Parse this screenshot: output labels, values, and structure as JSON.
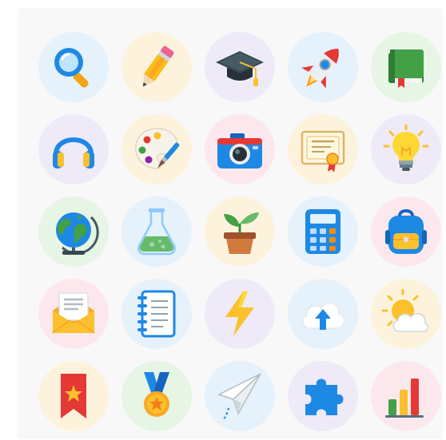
{
  "icons": [
    {
      "name": "search",
      "bg": "#e5f1fb"
    },
    {
      "name": "pencil",
      "bg": "#fdf3dc"
    },
    {
      "name": "graduation-cap",
      "bg": "#efeaf8"
    },
    {
      "name": "rocket",
      "bg": "#e5f1fb"
    },
    {
      "name": "book",
      "bg": "#e6f5e4"
    },
    {
      "name": "headphones",
      "bg": "#efeaf8"
    },
    {
      "name": "palette",
      "bg": "#fdf3dc"
    },
    {
      "name": "camera",
      "bg": "#fce8ec"
    },
    {
      "name": "certificate",
      "bg": "#fdf3dc"
    },
    {
      "name": "lightbulb",
      "bg": "#efeaf8"
    },
    {
      "name": "globe",
      "bg": "#e6f5e4"
    },
    {
      "name": "flask",
      "bg": "#e5f1fb"
    },
    {
      "name": "plant",
      "bg": "#fdf3dc"
    },
    {
      "name": "calculator",
      "bg": "#e5f1fb"
    },
    {
      "name": "backpack",
      "bg": "#fce8ec"
    },
    {
      "name": "envelope",
      "bg": "#fce8ec"
    },
    {
      "name": "notebook",
      "bg": "#e5f1fb"
    },
    {
      "name": "lightning",
      "bg": "#efeaf8"
    },
    {
      "name": "cloud-upload",
      "bg": "#e5f1fb"
    },
    {
      "name": "weather-sun-cloud",
      "bg": "#fdf3dc"
    },
    {
      "name": "bookmark",
      "bg": "#fdf3dc"
    },
    {
      "name": "medal",
      "bg": "#e6f5e4"
    },
    {
      "name": "paper-plane",
      "bg": "#e5f1fb"
    },
    {
      "name": "puzzle",
      "bg": "#efeaf8"
    },
    {
      "name": "bar-chart",
      "bg": "#fce8ec"
    }
  ]
}
